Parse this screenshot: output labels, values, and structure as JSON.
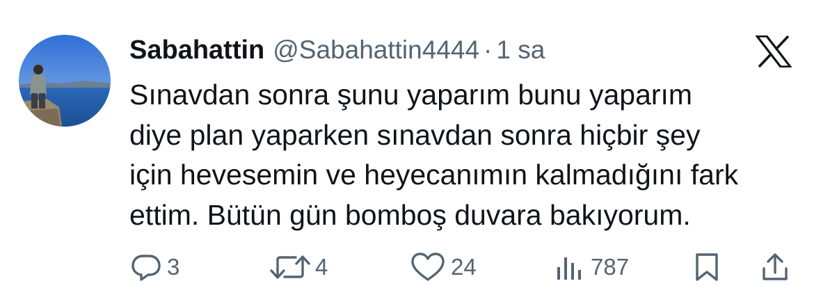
{
  "tweet": {
    "author": {
      "display_name": "Sabahattin",
      "handle": "@Sabahattin4444"
    },
    "separator": "·",
    "time": "1 sa",
    "text_lines": [
      "Sınavdan sonra şunu yaparım bunu yaparım",
      "diye plan yaparken sınavdan sonra hiçbir şey",
      "için hevesemin ve heyecanımın kalmadığını fark",
      "ettim. Bütün gün bomboş duvara bakıyorum."
    ],
    "metrics": {
      "replies": "3",
      "retweets": "4",
      "likes": "24",
      "views": "787"
    }
  },
  "icons": {
    "platform_logo": "x-logo-icon",
    "reply": "reply-icon",
    "retweet": "retweet-icon",
    "like": "heart-icon",
    "views": "views-icon",
    "bookmark": "bookmark-icon",
    "share": "share-icon"
  },
  "colors": {
    "text_primary": "#0f1419",
    "text_secondary": "#536471",
    "background": "#ffffff"
  }
}
